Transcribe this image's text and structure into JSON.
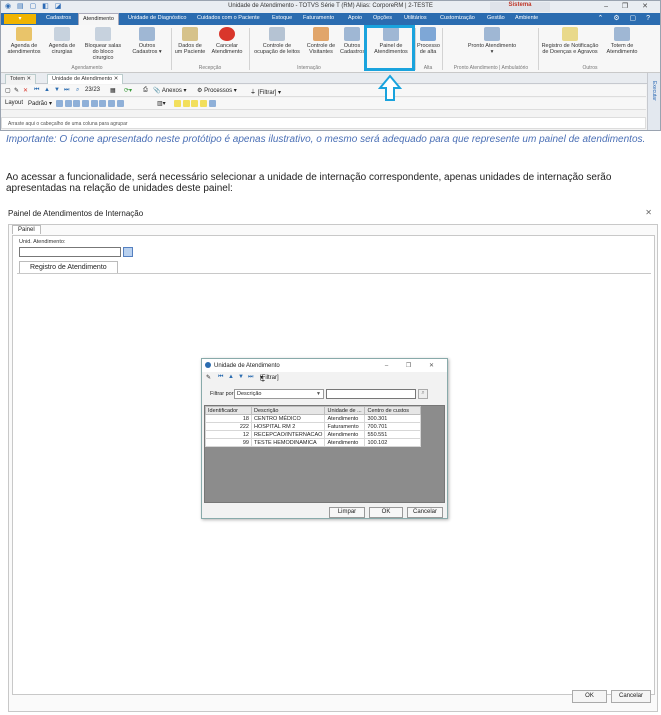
{
  "top_window": {
    "title": "Unidade de Atendimento - TOTVS Série T  (RM)   Alias: CorporeRM | 2-TESTE",
    "system_label": "Sistema",
    "file_button": "",
    "menu": [
      "Cadastros",
      "Atendimento",
      "Unidade de Diagnóstico",
      "Cuidados com o Paciente",
      "Estoque",
      "Faturamento",
      "Apoio",
      "Opções",
      "Utilitários",
      "Customização",
      "Gestão",
      "Ambiente"
    ],
    "ribbon": {
      "agenda_atend": "Agenda de atendimentos",
      "agenda_cir": "Agenda de cirurgias",
      "bloquear": "Bloquear salas do bloco cirurgico",
      "outros_cad": "Outros Cadastros ▾",
      "dados_paciente": "Dados de um Paciente",
      "cancelar_atend": "Cancelar Atendimento",
      "controle_ocup": "Controle de ocupação de leitos",
      "controle_vis": "Controle de Visitantes",
      "outros_cadastros": "Outros Cadastros",
      "painel_atend": "Painel de Atendimentos",
      "processo_alta": "Processo de alta",
      "pronto_atend": "Pronto Atendimento ▾",
      "registro_notif": "Registro de Notificação de Doenças e Agravos",
      "totem": "Totem de Atendimento",
      "groups": [
        "Agendamento",
        "Recepção",
        "Internação",
        "Alta",
        "Pronto Atendimento | Ambulatório",
        "Outros"
      ]
    },
    "doc_tabs": [
      "Totem",
      "Unidade de Atendimento"
    ],
    "toolbar_page": "23/23",
    "toolbar_anexos": "Anexos",
    "toolbar_processos": "Processos",
    "toolbar_filtrar": "[Filtrar]",
    "layout_label": "Layout",
    "padrao_label": "Padrão",
    "group_hint": "Arraste aqui o cabeçalho de uma coluna para agrupar",
    "side_panel": "Executar"
  },
  "note_text": "Importante: O ícone apresentado neste protótipo é apenas ilustrativo, o mesmo será adequado para que represente um painel de atendimentos.",
  "paragraph_text": "Ao acessar a funcionalidade, será necessário selecionar a unidade de internação correspondente, apenas unidades de internação serão apresentadas na relação de unidades deste painel:",
  "panel_window": {
    "title": "Painel de Atendimentos de Internação",
    "tab_painel": "Painel",
    "unid_label": "Unid. Atendimento:",
    "tab_registro": "Registro de Atendimento",
    "ok": "OK",
    "cancel": "Cancelar"
  },
  "dialog": {
    "title": "Unidade de Atendimento",
    "filtrar": "[Filtrar]",
    "filter_by_label": "Filtrar por:",
    "filter_by_value": "Descrição",
    "columns": [
      "Identificador",
      "Descrição",
      "Unidade de ...",
      "Centro de custos"
    ],
    "rows": [
      [
        "18",
        "CENTRO MÉDICO",
        "Atendimento",
        "300.301"
      ],
      [
        "222",
        "HOSPITAL RM 2",
        "Faturamento",
        "700.701"
      ],
      [
        "12",
        "RECEPCAO/INTERNACAO",
        "Atendimento",
        "550.551"
      ],
      [
        "99",
        "TESTE HEMODINAMICA",
        "Atendimento",
        "100.102"
      ]
    ],
    "limpar": "Limpar",
    "ok": "OK",
    "cancel": "Cancelar"
  },
  "colors": {
    "accent_blue": "#2b6cb0",
    "highlight": "#1aa3dd",
    "note_text": "#4a6fb5"
  }
}
